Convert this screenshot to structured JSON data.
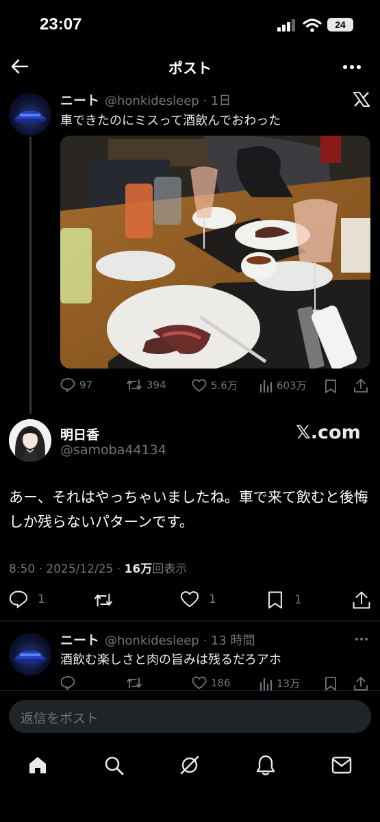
{
  "status_bar": {
    "time": "23:07",
    "battery": "24"
  },
  "header": {
    "title": "ポスト"
  },
  "tweet1": {
    "name": "ニート",
    "handle_meta": "@honkidesleep · 1日",
    "text": "車できたのにミスって酒飲んでおわった",
    "metrics": {
      "replies": "97",
      "reposts": "394",
      "likes": "5.6万",
      "views": "603万"
    }
  },
  "main_tweet": {
    "name": "明日香",
    "handle": "@samoba44134",
    "source_logo": "𝕏.com",
    "text": "あー、それはやっちゃいましたね。車で来て飲むと後悔しか残らないパターンです。",
    "meta_prefix": "8:50 · 2025/12/25 · ",
    "views_count": "16万",
    "views_suffix": "回表示",
    "actions": {
      "replies": "1",
      "likes": "1",
      "bookmarks": "1"
    }
  },
  "tweet3": {
    "name": "ニート",
    "handle_meta": "@honkidesleep · 13 時間",
    "text": "酒飲む楽しさと肉の旨みは残るだろアホ",
    "metrics": {
      "likes": "186",
      "views": "13万"
    }
  },
  "reply_box": {
    "placeholder": "返信をポスト"
  },
  "nav": [
    "home-icon",
    "search-icon",
    "grok-icon",
    "notifications-icon",
    "messages-icon"
  ]
}
